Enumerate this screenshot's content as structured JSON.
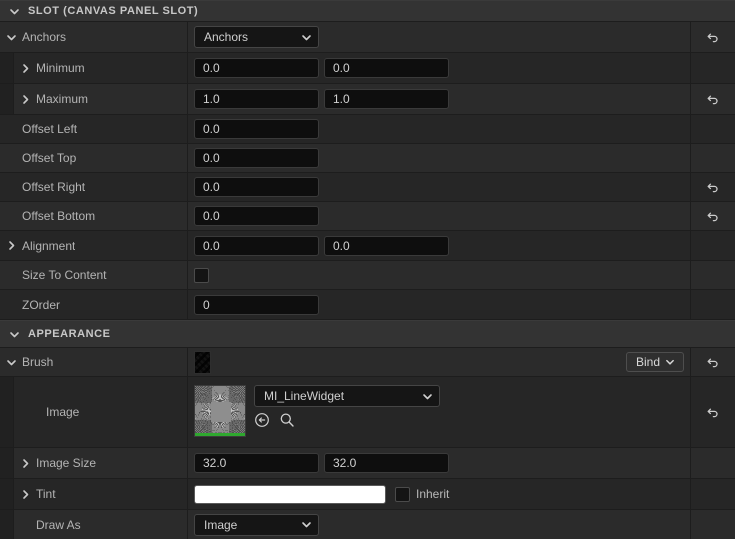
{
  "panel": {
    "colors": {
      "background": "#242424",
      "row_alt": "#2b2b2b",
      "row_base": "#262626",
      "section_header": "#333333",
      "input_bg": "#0e0e0e",
      "label_text": "#b4b4b4",
      "value_text": "#d2d2d2",
      "tint_swatch": "#ffffff",
      "thumbnail_accent": "#2fa82f"
    }
  },
  "sections": [
    {
      "id": "slot",
      "title": "SLOT (CANVAS PANEL SLOT)",
      "expanded_icon": "chevron-down-icon"
    },
    {
      "id": "appearance",
      "title": "APPEARANCE",
      "expanded_icon": "chevron-down-icon"
    }
  ],
  "slot_rows": {
    "anchors": {
      "label": "Anchors",
      "twisty": "chevron-down-icon",
      "combo_value": "Anchors",
      "combo_icon": "chevron-down-icon",
      "reset": "reset-arrow-icon"
    },
    "minimum": {
      "label": "Minimum",
      "twisty": "chevron-right-icon",
      "x": "0.0",
      "y": "0.0"
    },
    "maximum": {
      "label": "Maximum",
      "twisty": "chevron-right-icon",
      "x": "1.0",
      "y": "1.0",
      "reset": "reset-arrow-icon"
    },
    "offset_left": {
      "label": "Offset Left",
      "value": "0.0"
    },
    "offset_top": {
      "label": "Offset Top",
      "value": "0.0"
    },
    "offset_right": {
      "label": "Offset Right",
      "value": "0.0",
      "reset": "reset-arrow-icon"
    },
    "offset_bottom": {
      "label": "Offset Bottom",
      "value": "0.0",
      "reset": "reset-arrow-icon"
    },
    "alignment": {
      "label": "Alignment",
      "twisty": "chevron-right-icon",
      "x": "0.0",
      "y": "0.0"
    },
    "size_to_content": {
      "label": "Size To Content",
      "checked": false
    },
    "zorder": {
      "label": "ZOrder",
      "value": "0"
    }
  },
  "appearance_rows": {
    "brush": {
      "label": "Brush",
      "twisty": "chevron-down-icon",
      "thumbnail": "brush-thumbnail",
      "bind_label": "Bind",
      "bind_icon": "chevron-down-icon",
      "reset": "reset-arrow-icon"
    },
    "image": {
      "label": "Image",
      "thumbnail": "material-thumbnail",
      "asset_value": "MI_LineWidget",
      "asset_icon": "chevron-down-icon",
      "browse_icon": "browse-to-asset-icon",
      "search_icon": "search-icon",
      "reset": "reset-arrow-icon"
    },
    "image_size": {
      "label": "Image Size",
      "twisty": "chevron-right-icon",
      "x": "32.0",
      "y": "32.0"
    },
    "tint": {
      "label": "Tint",
      "twisty": "chevron-right-icon",
      "swatch_color": "#ffffff",
      "inherit_label": "Inherit",
      "inherit_checked": false
    },
    "draw_as": {
      "label": "Draw As",
      "combo_value": "Image",
      "combo_icon": "chevron-down-icon"
    }
  }
}
